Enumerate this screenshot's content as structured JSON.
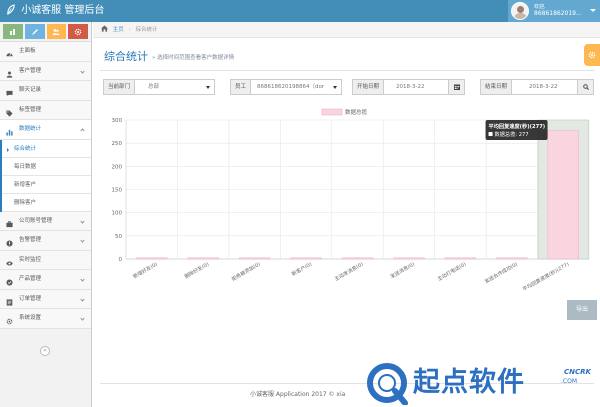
{
  "app": {
    "title": "小诚客服 管理后台"
  },
  "user": {
    "welcome": "欢迎,",
    "name": "86861862019..."
  },
  "shortcuts": [
    {
      "icon": "chart-icon",
      "color": "#87b87f"
    },
    {
      "icon": "pencil-icon",
      "color": "#6fb3e0"
    },
    {
      "icon": "users-icon",
      "color": "#ffb752"
    },
    {
      "icon": "gear-icon",
      "color": "#d15b47"
    }
  ],
  "menu": {
    "items_before": [
      {
        "label": "主面板",
        "icon": "dashboard-icon",
        "has_arrow": false
      },
      {
        "label": "客户管理",
        "icon": "user-icon",
        "has_arrow": true
      },
      {
        "label": "聊天记录",
        "icon": "chat-icon",
        "has_arrow": false
      },
      {
        "label": "标签管理",
        "icon": "tag-icon",
        "has_arrow": false
      }
    ],
    "active": {
      "label": "数据统计",
      "icon": "bar-chart-icon"
    },
    "sub_items": [
      "综合统计",
      "每日数据",
      "新增客户",
      "删除客户"
    ],
    "items_after": [
      {
        "label": "公司账号管理",
        "icon": "briefcase-icon",
        "has_arrow": true
      },
      {
        "label": "告警管理",
        "icon": "alert-icon",
        "has_arrow": true
      },
      {
        "label": "实时监控",
        "icon": "eye-icon",
        "has_arrow": false
      },
      {
        "label": "产品管理",
        "icon": "product-icon",
        "has_arrow": true
      },
      {
        "label": "订单管理",
        "icon": "order-icon",
        "has_arrow": true
      },
      {
        "label": "系统设置",
        "icon": "gear-icon",
        "has_arrow": true
      }
    ],
    "collapse_glyph": "«"
  },
  "breadcrumb": {
    "home": "主页",
    "current": "综合统计"
  },
  "page": {
    "title": "综合统计",
    "description": "选择时间范围查看客户数据详情"
  },
  "filters": {
    "department": {
      "label": "当前部门",
      "value": "总部"
    },
    "employee": {
      "label": "员工",
      "value": "868618620198864（dor"
    },
    "start_date": {
      "label": "开始日期",
      "value": "2018-3-22"
    },
    "end_date": {
      "label": "结束日期",
      "value": "2018-3-22"
    }
  },
  "chart_data": {
    "type": "bar",
    "legend": "数据总揽",
    "legend_color": "#f9d5e0",
    "categories": [
      "新增好友(0)",
      "删除好友(0)",
      "拒绝被添加(0)",
      "新客户(0)",
      "主动发消息(0)",
      "发送消息(0)",
      "主动打电话(0)",
      "发送合作成功(0)",
      "平均回复速度(秒)(277)"
    ],
    "values": [
      0,
      0,
      0,
      0,
      0,
      0,
      0,
      0,
      277
    ],
    "ylim": [
      0,
      300
    ],
    "yticks": [
      0,
      50,
      100,
      150,
      200,
      250,
      300
    ],
    "tooltip": {
      "title": "平均回复速度(秒)(277)",
      "line": "数据总揽: 277"
    },
    "highlight_index": 8,
    "highlight_fill": "#e3e8e3"
  },
  "actions": {
    "export": "导出"
  },
  "footer": {
    "text": "小诚客服 Application 2017 © xia"
  },
  "watermark": {
    "text": "起点软件",
    "brand": "CNCRK",
    "domain": ".COM"
  }
}
